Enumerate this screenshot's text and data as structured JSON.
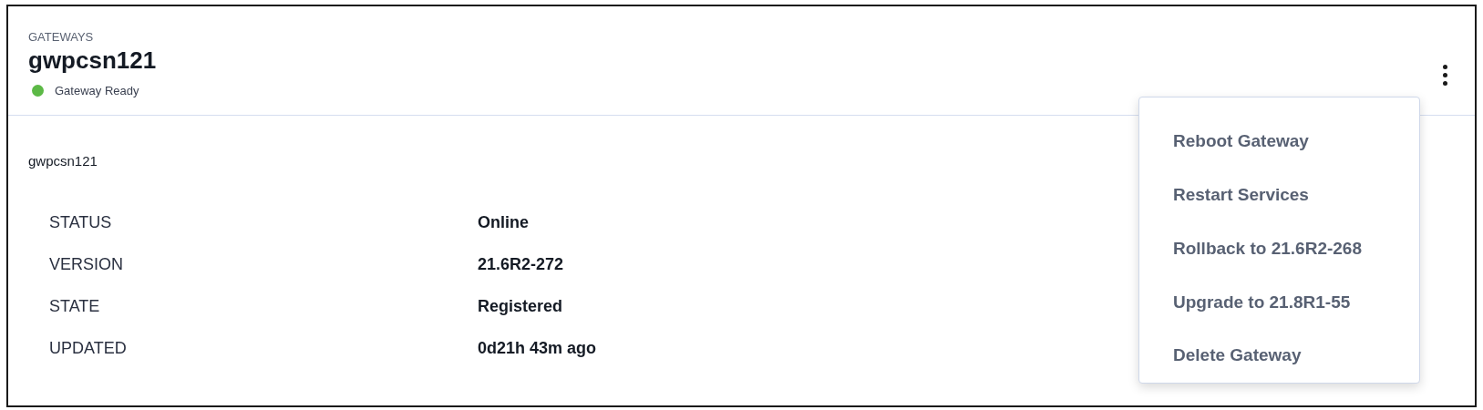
{
  "header": {
    "section": "GATEWAYS",
    "title": "gwpcsn121",
    "status": {
      "label": "Gateway Ready",
      "color": "#5cb946"
    }
  },
  "subtitle": "gwpcsn121",
  "details": [
    {
      "label": "STATUS",
      "value": "Online"
    },
    {
      "label": "VERSION",
      "value": "21.6R2-272"
    },
    {
      "label": "STATE",
      "value": "Registered"
    },
    {
      "label": "UPDATED",
      "value": "0d21h 43m ago"
    }
  ],
  "menu": {
    "items": [
      "Reboot Gateway",
      "Restart Services",
      "Rollback to 21.6R2-268",
      "Upgrade to 21.8R1-55",
      "Delete Gateway"
    ]
  }
}
